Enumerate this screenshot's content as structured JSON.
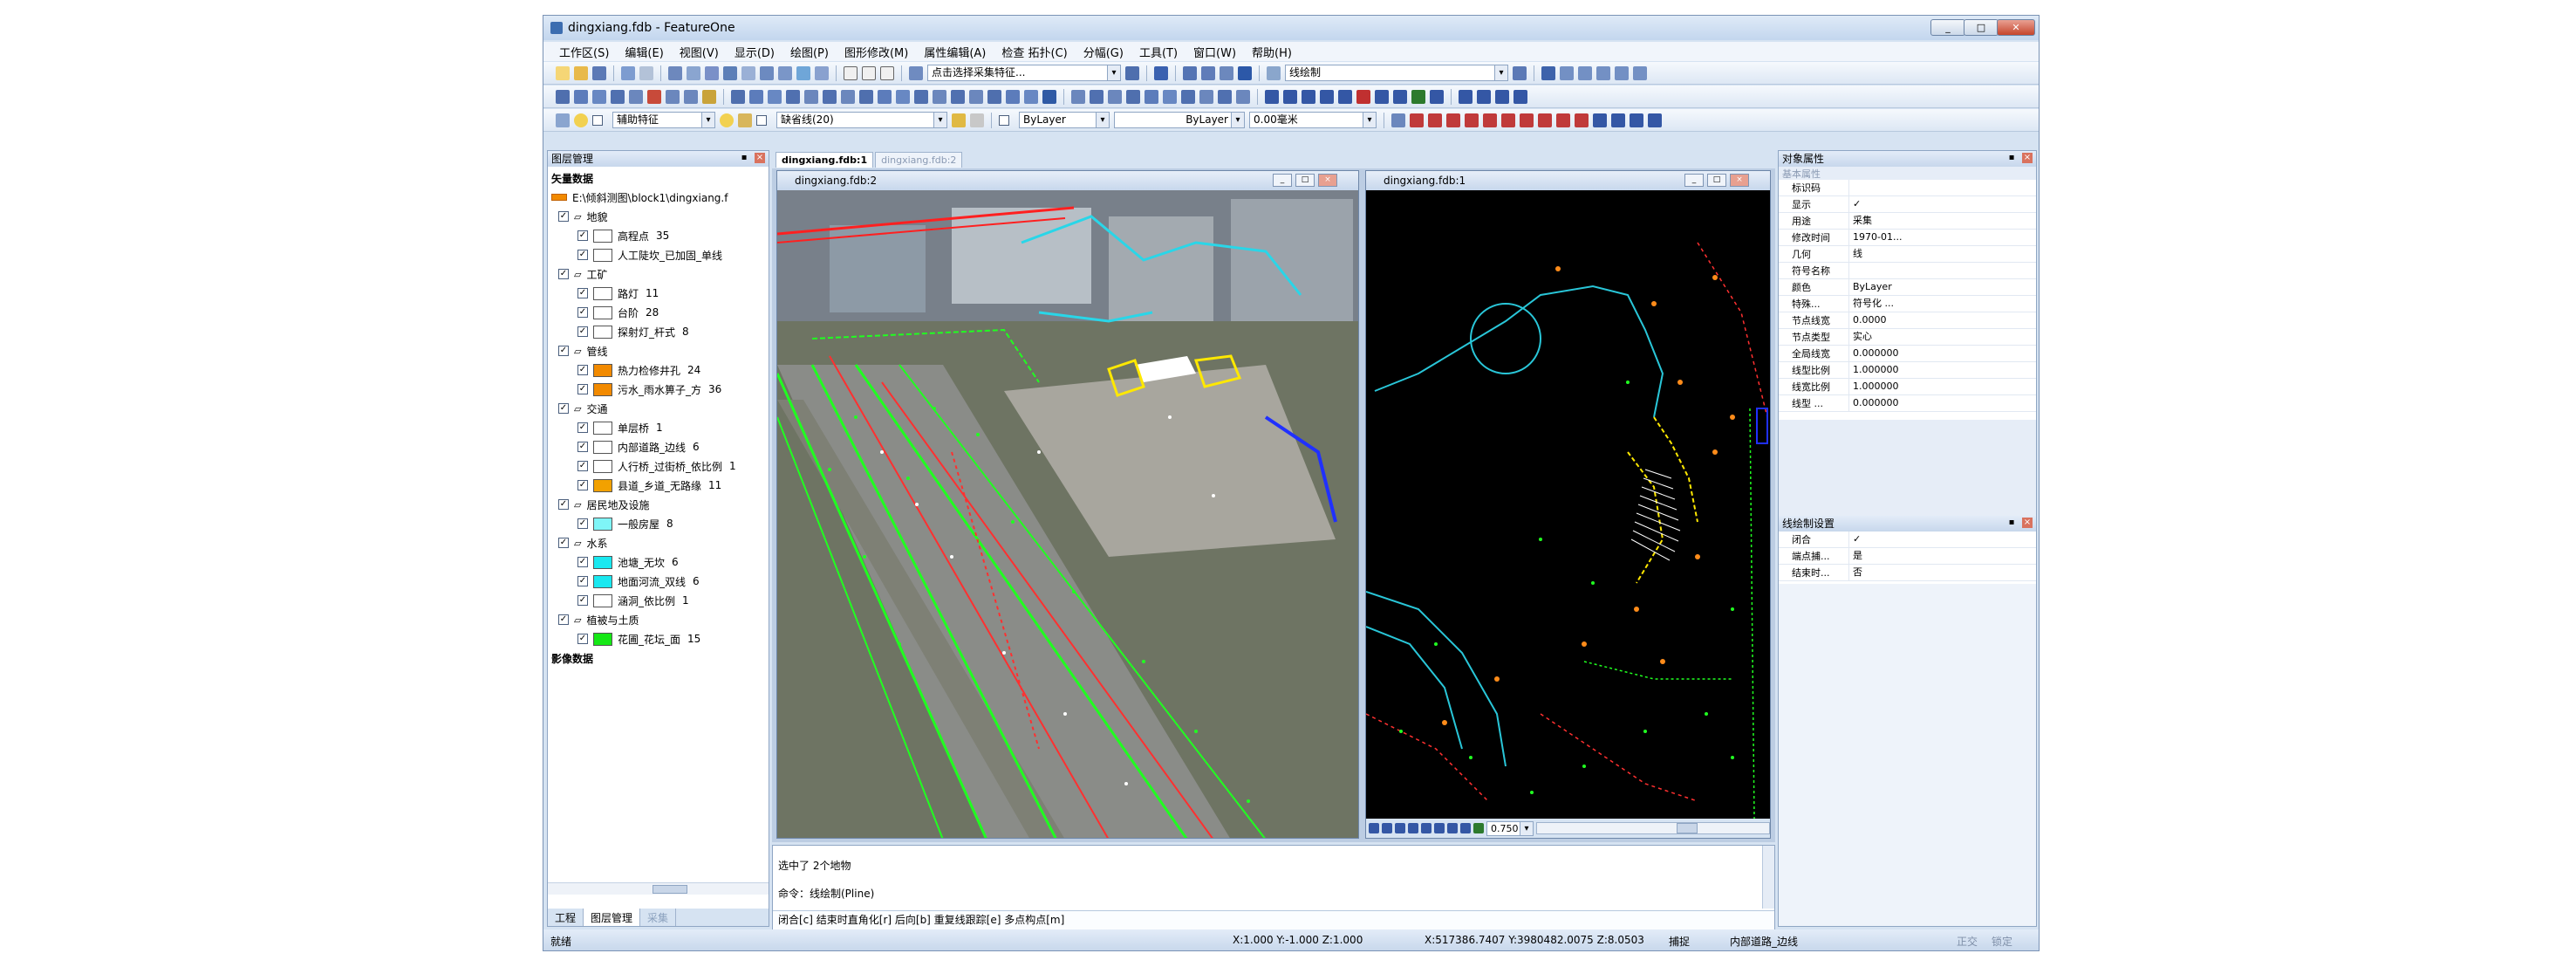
{
  "window": {
    "title": "dingxiang.fdb - FeatureOne",
    "min": "_",
    "max": "□",
    "close": "✕"
  },
  "menu": [
    "工作区(S)",
    "编辑(E)",
    "视图(V)",
    "显示(D)",
    "绘图(P)",
    "图形修改(M)",
    "属性编辑(A)",
    "检查 拓扑(C)",
    "分幅(G)",
    "工具(T)",
    "窗口(W)",
    "帮助(H)"
  ],
  "toolbar": {
    "select_combo": "点击选择采集特征...",
    "draw_combo": "线绘制",
    "aux_label": "辅助特征",
    "line_combo": "缺省线(20)",
    "bylayer1": "ByLayer",
    "bylayer2": "ByLayer",
    "linewidth": "0.00毫米"
  },
  "layerpanel": {
    "header": "图层管理",
    "root": "矢量数据",
    "path": "E:\\倾斜测图\\block1\\dingxiang.f",
    "groups": [
      {
        "name": "地貌",
        "items": [
          {
            "label": "高程点",
            "count": "35",
            "color": "#ffffff"
          },
          {
            "label": "人工陡坎_已加固_单线",
            "count": "",
            "color": "#ffffff"
          }
        ]
      },
      {
        "name": "工矿",
        "items": [
          {
            "label": "路灯",
            "count": "11",
            "color": "#ffffff"
          },
          {
            "label": "台阶",
            "count": "28",
            "color": "#ffffff"
          },
          {
            "label": "探射灯_杆式",
            "count": "8",
            "color": "#ffffff"
          }
        ]
      },
      {
        "name": "管线",
        "items": [
          {
            "label": "热力检修井孔",
            "count": "24",
            "color": "#f28a00"
          },
          {
            "label": "污水_雨水箅子_方",
            "count": "36",
            "color": "#f28a00"
          }
        ]
      },
      {
        "name": "交通",
        "items": [
          {
            "label": "单层桥",
            "count": "1",
            "color": "#ffffff"
          },
          {
            "label": "内部道路_边线",
            "count": "6",
            "color": "#ffffff"
          },
          {
            "label": "人行桥_过街桥_依比例",
            "count": "1",
            "color": "#ffffff"
          },
          {
            "label": "县道_乡道_无路缘",
            "count": "11",
            "color": "#f2a100"
          }
        ]
      },
      {
        "name": "居民地及设施",
        "items": [
          {
            "label": "一般房屋",
            "count": "8",
            "color": "#7ff5f7"
          }
        ]
      },
      {
        "name": "水系",
        "items": [
          {
            "label": "池塘_无坎",
            "count": "6",
            "color": "#19e8f0"
          },
          {
            "label": "地面河流_双线",
            "count": "6",
            "color": "#19e8f0"
          },
          {
            "label": "涵洞_依比例",
            "count": "1",
            "color": "#ffffff"
          }
        ]
      },
      {
        "name": "植被与土质",
        "items": [
          {
            "label": "花圃_花坛_面",
            "count": "15",
            "color": "#16e816"
          }
        ]
      }
    ],
    "footer": "影像数据",
    "tabs": [
      "工程",
      "图层管理",
      "采集"
    ]
  },
  "doc_tabs": [
    "dingxiang.fdb:1",
    "dingxiang.fdb:2"
  ],
  "mapwin2": {
    "title": "dingxiang.fdb:2"
  },
  "mapwin1": {
    "title": "dingxiang.fdb:1",
    "zoom": "0.750"
  },
  "command": {
    "line1": "选中了  2个地物",
    "line2": "命令：线绘制(Pline)",
    "line3": "闭合[c] 结束时直角化[r] 后向[b] 重复线跟踪[e] 多点构点[m]"
  },
  "props": {
    "header": "对象属性",
    "section": "基本属性",
    "rows": [
      [
        "标识码",
        ""
      ],
      [
        "显示",
        "✓"
      ],
      [
        "用途",
        "采集"
      ],
      [
        "修改时间",
        "1970-01..."
      ],
      [
        "几何",
        "线"
      ],
      [
        "符号名称",
        ""
      ],
      [
        "颜色",
        "ByLayer"
      ],
      [
        "特殊...",
        "符号化 ..."
      ],
      [
        "节点线宽",
        "0.0000"
      ],
      [
        "节点类型",
        "实心"
      ],
      [
        "全局线宽",
        "0.000000"
      ],
      [
        "线型比例",
        "1.000000"
      ],
      [
        "线宽比例",
        "1.000000"
      ],
      [
        "线型 ...",
        "0.000000"
      ]
    ]
  },
  "linesettings": {
    "header": "线绘制设置",
    "rows": [
      [
        "闭合",
        "✓"
      ],
      [
        "端点捕...",
        "是"
      ],
      [
        "结束时...",
        "否"
      ]
    ]
  },
  "status": {
    "left": "就绪",
    "coord1": "X:1.000 Y:-1.000 Z:1.000",
    "coord2": "X:517386.7407 Y:3980482.0075 Z:8.0503",
    "snap": "捕捉",
    "layer": "内部道路_边线",
    "ortho": "正交",
    "lock": "锁定"
  },
  "colors": {
    "accent": "#3c6db0",
    "map_bg": "#000000"
  }
}
